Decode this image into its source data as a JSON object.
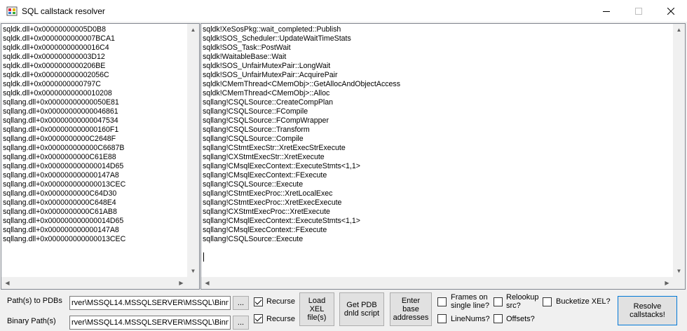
{
  "window": {
    "title": "SQL callstack resolver"
  },
  "addresses": [
    "sqldk.dll+0x00000000005D0B8",
    "sqldk.dll+0x0000000000007BCA1",
    "sqldk.dll+0x00000000000016C4",
    "sqldk.dll+0x000000000003D12",
    "sqldk.dll+0x0000000000206BE",
    "sqldk.dll+0x000000000002056C",
    "sqldk.dll+0x0000000000797C",
    "sqldk.dll+0x00000000000010208",
    "sqllang.dll+0x00000000000050E81",
    "sqllang.dll+0x00000000000046861",
    "sqllang.dll+0x00000000000047534",
    "sqllang.dll+0x000000000000160F1",
    "sqllang.dll+0x0000000000C2648F",
    "sqllang.dll+0x000000000000C6687B",
    "sqllang.dll+0x0000000000C61E88",
    "sqllang.dll+0x000000000000014D65",
    "sqllang.dll+0x000000000000147A8",
    "sqllang.dll+0x000000000000013CEC",
    "sqllang.dll+0x0000000000C64D30",
    "sqllang.dll+0x0000000000C648E4",
    "sqllang.dll+0x0000000000C61AB8",
    "sqllang.dll+0x000000000000014D65",
    "sqllang.dll+0x000000000000147A8",
    "sqllang.dll+0x000000000000013CEC"
  ],
  "symbols": [
    "sqldk!XeSosPkg::wait_completed::Publish",
    "sqldk!SOS_Scheduler::UpdateWaitTimeStats",
    "sqldk!SOS_Task::PostWait",
    "sqldk!WaitableBase::Wait",
    "sqldk!SOS_UnfairMutexPair::LongWait",
    "sqldk!SOS_UnfairMutexPair::AcquirePair",
    "sqldk!CMemThread<CMemObj>::GetAllocAndObjectAccess",
    "sqldk!CMemThread<CMemObj>::Alloc",
    "sqllang!CSQLSource::CreateCompPlan",
    "sqllang!CSQLSource::FCompile",
    "sqllang!CSQLSource::FCompWrapper",
    "sqllang!CSQLSource::Transform",
    "sqllang!CSQLSource::Compile",
    "sqllang!CStmtExecStr::XretExecStrExecute",
    "sqllang!CXStmtExecStr::XretExecute",
    "sqllang!CMsqlExecContext::ExecuteStmts<1,1>",
    "sqllang!CMsqlExecContext::FExecute",
    "sqllang!CSQLSource::Execute",
    "sqllang!CStmtExecProc::XretLocalExec",
    "sqllang!CStmtExecProc::XretExecExecute",
    "sqllang!CXStmtExecProc::XretExecute",
    "sqllang!CMsqlExecContext::ExecuteStmts<1,1>",
    "sqllang!CMsqlExecContext::FExecute",
    "sqllang!CSQLSource::Execute"
  ],
  "bottom": {
    "pdb_label": "Path(s) to PDBs",
    "pdb_value": "rver\\MSSQL14.MSSQLSERVER\\MSSQL\\Binn",
    "binary_label": "Binary Path(s)",
    "binary_value": "rver\\MSSQL14.MSSQLSERVER\\MSSQL\\Binn",
    "browse": "...",
    "recurse": "Recurse",
    "load_xel": [
      "Load",
      "XEL",
      "file(s)"
    ],
    "get_pdb": [
      "Get PDB",
      "dnld script"
    ],
    "enter_base": [
      "Enter",
      "base",
      "addresses"
    ],
    "frames_single": [
      "Frames on",
      "single line?"
    ],
    "relookup": [
      "Relookup",
      "src?"
    ],
    "bucketize": "Bucketize XEL?",
    "linenums": "LineNums?",
    "offsets": "Offsets?",
    "resolve": [
      "Resolve",
      "callstacks!"
    ]
  }
}
